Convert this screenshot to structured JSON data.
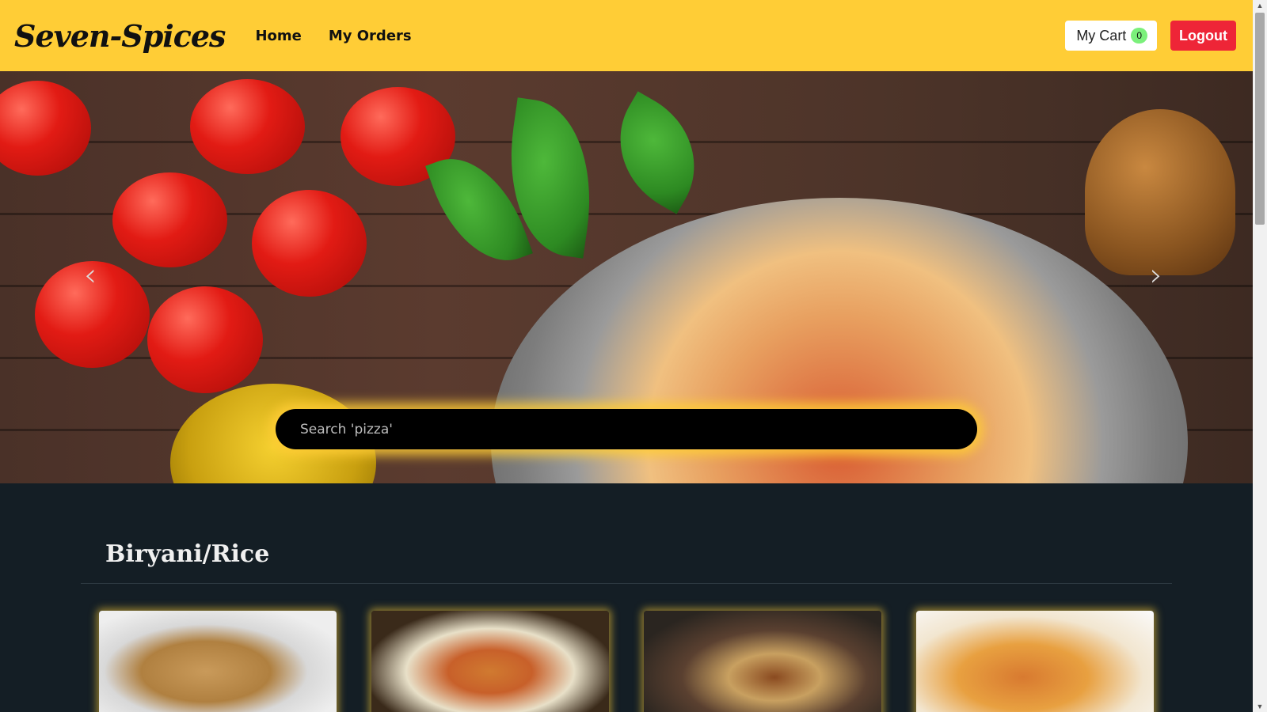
{
  "navbar": {
    "brand": "Seven-Spices",
    "links": [
      {
        "label": "Home"
      },
      {
        "label": "My Orders"
      }
    ],
    "cart_label": "My Cart",
    "cart_count": "0",
    "logout_label": "Logout"
  },
  "hero": {
    "prev_icon": "‹",
    "next_icon": "›",
    "search_placeholder": "Search 'pizza'"
  },
  "section": {
    "title": "Biryani/Rice",
    "cards": [
      {
        "name": "rice-card-1"
      },
      {
        "name": "rice-card-2"
      },
      {
        "name": "rice-card-3"
      },
      {
        "name": "rice-card-4"
      }
    ]
  },
  "colors": {
    "navbar_bg": "#ffcd36",
    "logout_bg": "#ee2537",
    "badge_bg": "#7bf07b",
    "page_bg": "#141e25"
  },
  "scrollbar": {
    "up_icon": "▲",
    "down_icon": "▼"
  }
}
